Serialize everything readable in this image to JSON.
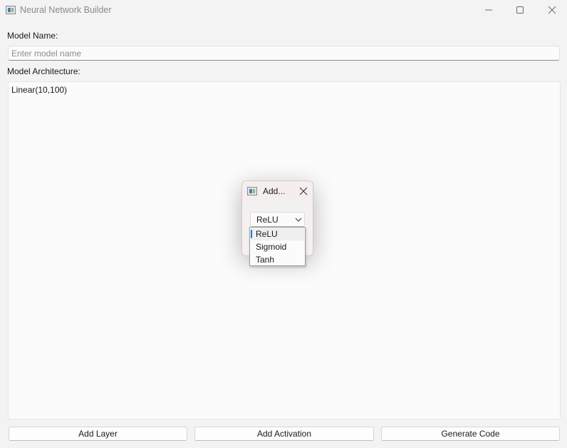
{
  "window": {
    "title": "Neural Network Builder",
    "icons": {
      "app": "app-icon",
      "minimize": "minimize-icon",
      "maximize": "maximize-icon",
      "close": "close-icon"
    }
  },
  "form": {
    "model_name_label": "Model Name:",
    "model_name_value": "",
    "model_name_placeholder": "Enter model name",
    "architecture_label": "Model Architecture:",
    "architecture_lines": [
      "Linear(10,100)"
    ]
  },
  "buttons": {
    "add_layer": "Add Layer",
    "add_activation": "Add Activation",
    "generate_code": "Generate Code"
  },
  "dialog": {
    "title": "Add...",
    "combo_selected": "ReLU",
    "options": [
      "ReLU",
      "Sigmoid",
      "Tanh"
    ],
    "highlighted_option": "ReLU"
  },
  "colors": {
    "accent": "#2a6fc9",
    "background": "#f3f3f3",
    "dialog_title_tint": "#f5eeee"
  }
}
